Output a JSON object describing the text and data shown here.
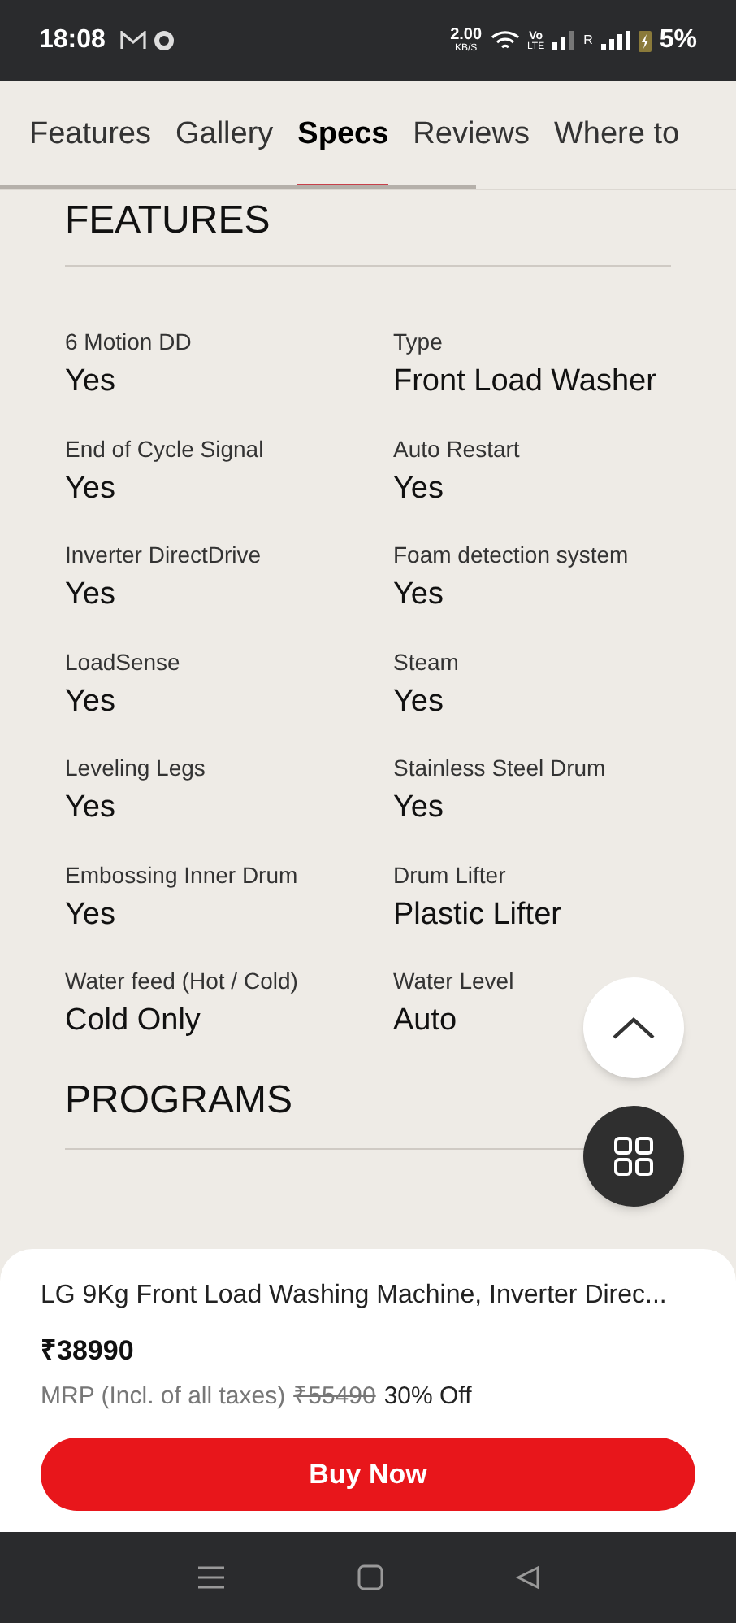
{
  "status_bar": {
    "time": "18:08",
    "net_speed": "2.00",
    "net_unit": "KB/S",
    "volte_top": "Vo",
    "volte_bottom": "LTE",
    "roaming": "R",
    "battery": "5%"
  },
  "tabs": [
    {
      "label": "Features",
      "selected": false
    },
    {
      "label": "Gallery",
      "selected": false
    },
    {
      "label": "Specs",
      "selected": true
    },
    {
      "label": "Reviews",
      "selected": false
    },
    {
      "label": "Where to",
      "selected": false
    }
  ],
  "features": {
    "heading": "FEATURES",
    "items": [
      {
        "label": "6 Motion DD",
        "value": "Yes"
      },
      {
        "label": "Type",
        "value": "Front Load Washer"
      },
      {
        "label": "End of Cycle Signal",
        "value": "Yes"
      },
      {
        "label": "Auto Restart",
        "value": "Yes"
      },
      {
        "label": "Inverter DirectDrive",
        "value": "Yes"
      },
      {
        "label": "Foam detection system",
        "value": "Yes"
      },
      {
        "label": "LoadSense",
        "value": "Yes"
      },
      {
        "label": "Steam",
        "value": "Yes"
      },
      {
        "label": "Leveling Legs",
        "value": "Yes"
      },
      {
        "label": "Stainless Steel Drum",
        "value": "Yes"
      },
      {
        "label": "Embossing Inner Drum",
        "value": "Yes"
      },
      {
        "label": "Drum Lifter",
        "value": "Plastic Lifter"
      },
      {
        "label": "Water feed (Hot / Cold)",
        "value": "Cold Only"
      },
      {
        "label": "Water Level",
        "value": "Auto"
      }
    ]
  },
  "programs": {
    "heading": "PROGRAMS"
  },
  "product": {
    "title": "LG 9Kg Front Load Washing Machine, Inverter Direc...",
    "price": "₹38990",
    "mrp_label": "MRP (Incl. of all taxes)",
    "original_price": "₹55490",
    "discount": "30% Off",
    "buy_button": "Buy Now"
  }
}
